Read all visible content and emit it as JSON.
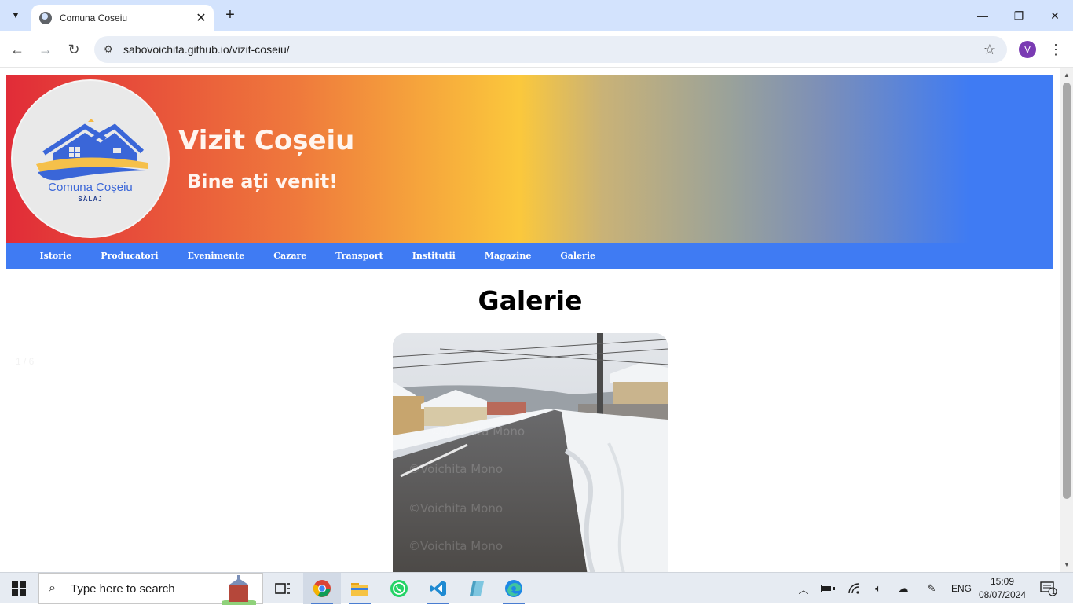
{
  "browser": {
    "tab_title": "Comuna Coseiu",
    "url": "sabovoichita.github.io/vizit-coseiu/",
    "profile_initial": "V"
  },
  "site": {
    "logo_name": "Comuna Coșeiu",
    "logo_sub": "SĂLAJ",
    "title": "Vizit Coșeiu",
    "subtitle": "Bine ați venit!"
  },
  "nav": [
    {
      "label": "Istorie"
    },
    {
      "label": "Producatori"
    },
    {
      "label": "Evenimente"
    },
    {
      "label": "Cazare"
    },
    {
      "label": "Transport"
    },
    {
      "label": "Institutii"
    },
    {
      "label": "Magazine"
    },
    {
      "label": "Galerie"
    }
  ],
  "gallery": {
    "heading": "Galerie",
    "counter": "1 / 6",
    "watermark": "©Voichita Mono"
  },
  "taskbar": {
    "search_placeholder": "Type here to search",
    "language": "ENG",
    "time": "15:09",
    "date": "08/07/2024",
    "notifications": "1"
  },
  "colors": {
    "nav_blue": "#3f7bf3",
    "header_red": "#e12c38",
    "header_yellow": "#fbc83c"
  }
}
